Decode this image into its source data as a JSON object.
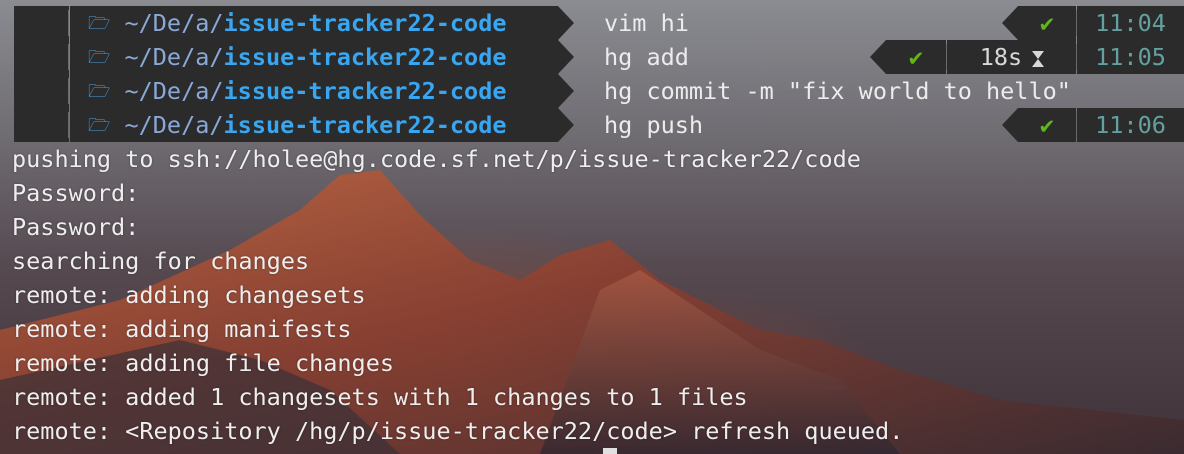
{
  "prompts": [
    {
      "os_icon": "apple-icon",
      "dir_prefix": "~/De/a/",
      "dir_repo": "issue-tracker22-code",
      "command": "vim hi",
      "status": "✔",
      "duration": "",
      "time": "11:04"
    },
    {
      "os_icon": "apple-icon",
      "dir_prefix": "~/De/a/",
      "dir_repo": "issue-tracker22-code",
      "command": "hg add",
      "status": "✔",
      "duration": "18s",
      "time": "11:05"
    },
    {
      "os_icon": "apple-icon",
      "dir_prefix": "~/De/a/",
      "dir_repo": "issue-tracker22-code",
      "command": "hg commit -m \"fix world to hello\"",
      "status": "",
      "duration": "",
      "time": ""
    },
    {
      "os_icon": "apple-icon",
      "dir_prefix": "~/De/a/",
      "dir_repo": "issue-tracker22-code",
      "command": "hg push",
      "status": "✔",
      "duration": "",
      "time": "11:06"
    }
  ],
  "output": [
    "pushing to ssh://holee@hg.code.sf.net/p/issue-tracker22/code",
    "Password:",
    "Password:",
    "searching for changes",
    "remote: adding changesets",
    "remote: adding manifests",
    "remote: adding file changes",
    "remote: added 1 changesets with 1 changes to 1 files",
    "remote: <Repository /hg/p/issue-tracker22/code> refresh queued."
  ],
  "colors": {
    "segment_bg": "#2b2b2b",
    "dir_repo": "#38a6f0",
    "dir_path": "#8aa9d8",
    "check": "#5fb818",
    "time": "#64a0a0"
  }
}
